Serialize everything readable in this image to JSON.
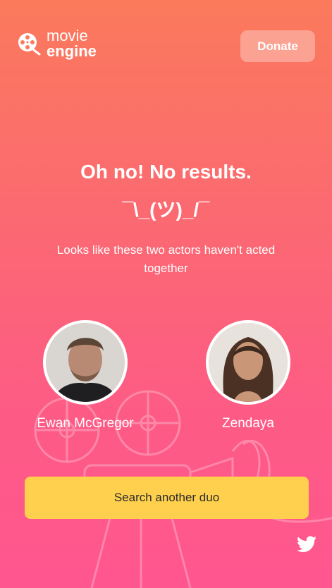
{
  "header": {
    "logo_line1": "movie",
    "logo_line2": "engine",
    "donate_label": "Donate"
  },
  "main": {
    "title": "Oh no! No results.",
    "shrug": "¯\\_(ツ)_/¯",
    "subtitle": "Looks like these two actors haven't acted together",
    "actors": [
      {
        "name": "Ewan McGregor"
      },
      {
        "name": "Zendaya"
      }
    ],
    "search_label": "Search another duo"
  },
  "footer": {
    "twitter_icon": "twitter-icon"
  },
  "colors": {
    "gradient_top": "#fb7a5c",
    "gradient_bottom": "#ff5690",
    "search_button": "#ffd04d"
  }
}
